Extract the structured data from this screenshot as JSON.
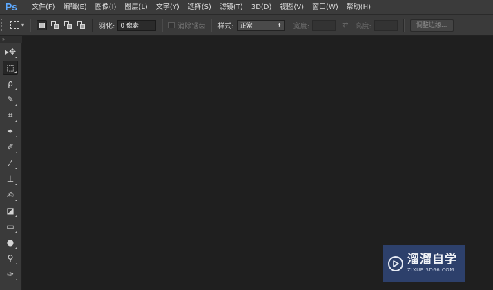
{
  "app": {
    "logo": "Ps"
  },
  "menu": {
    "items": [
      {
        "label": "文件(F)"
      },
      {
        "label": "编辑(E)"
      },
      {
        "label": "图像(I)"
      },
      {
        "label": "图层(L)"
      },
      {
        "label": "文字(Y)"
      },
      {
        "label": "选择(S)"
      },
      {
        "label": "滤镜(T)"
      },
      {
        "label": "3D(D)"
      },
      {
        "label": "视图(V)"
      },
      {
        "label": "窗口(W)"
      },
      {
        "label": "帮助(H)"
      }
    ]
  },
  "options": {
    "feather_label": "羽化:",
    "feather_value": "0 像素",
    "antialias_label": "消除锯齿",
    "style_label": "样式:",
    "style_value": "正常",
    "width_label": "宽度:",
    "height_label": "高度:",
    "refine_edge_label": "调整边缘..."
  },
  "tools": [
    {
      "icon": "move-tool-icon",
      "glyph": "▸✥",
      "active": false
    },
    {
      "icon": "rectangular-marquee-icon",
      "glyph": "⬚",
      "active": true
    },
    {
      "icon": "lasso-icon",
      "glyph": "ρ",
      "active": false
    },
    {
      "icon": "quick-selection-icon",
      "glyph": "✎",
      "active": false
    },
    {
      "icon": "crop-icon",
      "glyph": "⌗",
      "active": false
    },
    {
      "icon": "eyedropper-icon",
      "glyph": "✒",
      "active": false
    },
    {
      "icon": "healing-brush-icon",
      "glyph": "✐",
      "active": false
    },
    {
      "icon": "brush-icon",
      "glyph": "⁄",
      "active": false
    },
    {
      "icon": "clone-stamp-icon",
      "glyph": "⊥",
      "active": false
    },
    {
      "icon": "history-brush-icon",
      "glyph": "✍",
      "active": false
    },
    {
      "icon": "eraser-icon",
      "glyph": "◪",
      "active": false
    },
    {
      "icon": "gradient-icon",
      "glyph": "▭",
      "active": false
    },
    {
      "icon": "blur-icon",
      "glyph": "●",
      "active": false
    },
    {
      "icon": "dodge-icon",
      "glyph": "⚲",
      "active": false
    },
    {
      "icon": "pen-icon",
      "glyph": "✑",
      "active": false
    }
  ],
  "watermark": {
    "title": "溜溜自学",
    "subtitle": "ZIXUE.3D66.COM"
  },
  "colors": {
    "accent": "#5da9ff",
    "canvas": "#1f1f1f",
    "panel": "#3a3a3a",
    "watermark_bg": "#304676"
  }
}
